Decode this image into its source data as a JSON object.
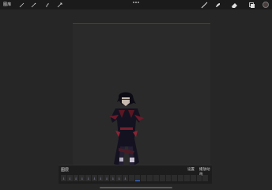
{
  "topbar": {
    "gallery_label": "图库",
    "left_tools": [
      "wrench-icon",
      "magic-wand-icon",
      "selection-icon",
      "transform-icon"
    ],
    "right_tools": [
      "brush-icon",
      "smudge-icon",
      "eraser-icon",
      "layers-icon"
    ],
    "color_swatch": "#4a3e3e"
  },
  "timeline": {
    "title": "图层",
    "settings_label": "设置",
    "play_label": "播放动画",
    "frame_count": 24,
    "active_frame": 12
  }
}
